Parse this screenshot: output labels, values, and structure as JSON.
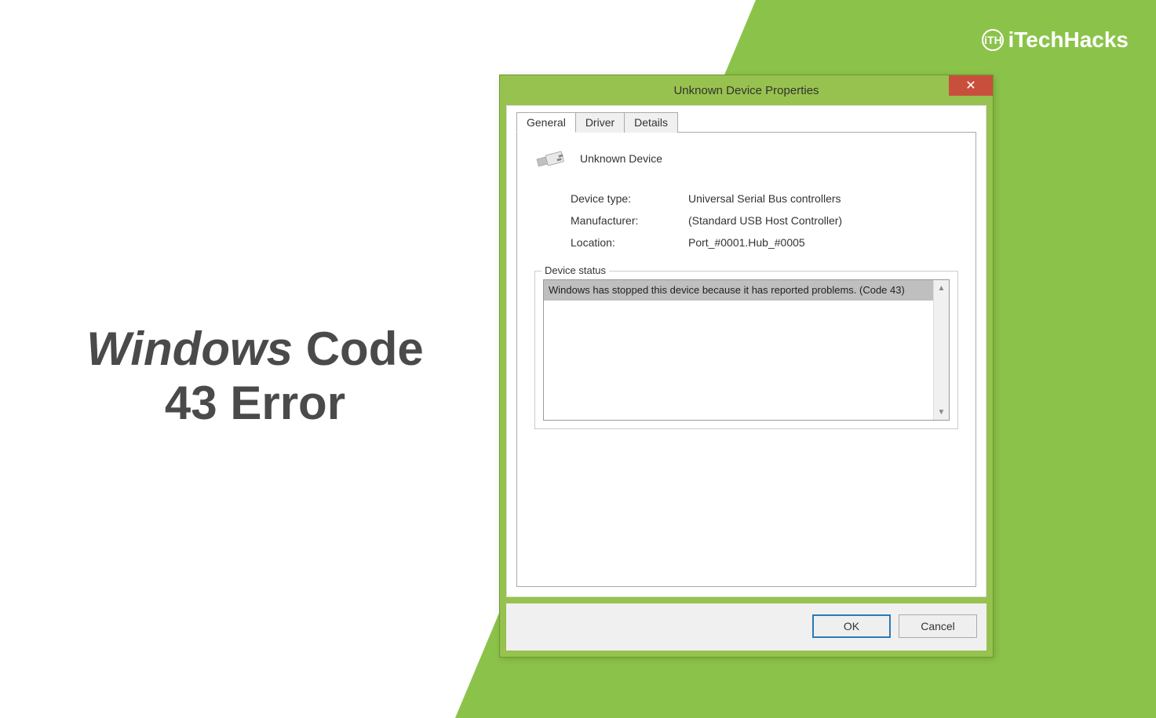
{
  "branding": {
    "logo_text": "iTechHacks",
    "badge_text": "iTH"
  },
  "headline": {
    "line1_italic": "Windows",
    "line1_rest": " Code",
    "line2": "43 Error"
  },
  "dialog": {
    "title": "Unknown Device Properties",
    "close_tooltip": "Close",
    "tabs": [
      "General",
      "Driver",
      "Details"
    ],
    "active_tab": 0,
    "device": {
      "name": "Unknown Device",
      "icon": "usb-connector-icon",
      "device_type_label": "Device type:",
      "device_type_value": "Universal Serial Bus controllers",
      "manufacturer_label": "Manufacturer:",
      "manufacturer_value": "(Standard USB Host Controller)",
      "location_label": "Location:",
      "location_value": "Port_#0001.Hub_#0005"
    },
    "status": {
      "legend": "Device status",
      "message": "Windows has stopped this device because it has reported problems. (Code 43)"
    },
    "buttons": {
      "ok": "OK",
      "cancel": "Cancel"
    }
  }
}
